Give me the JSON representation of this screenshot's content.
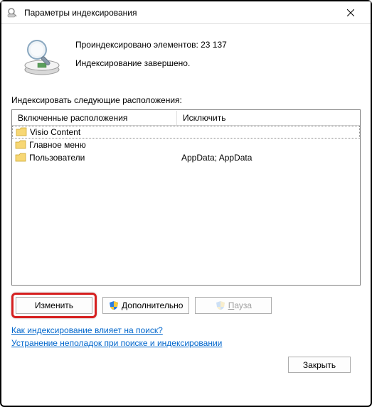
{
  "titlebar": {
    "title": "Параметры индексирования"
  },
  "status": {
    "indexed_label": "Проиндексировано элементов: 23 137",
    "state_label": "Индексирование завершено."
  },
  "section_label": "Индексировать следующие расположения:",
  "columns": {
    "included": "Включенные расположения",
    "excluded": "Исключить"
  },
  "rows": [
    {
      "name": "Visio Content",
      "excluded": ""
    },
    {
      "name": "Главное меню",
      "excluded": ""
    },
    {
      "name": "Пользователи",
      "excluded": "AppData; AppData"
    }
  ],
  "buttons": {
    "modify": "Изменить",
    "advanced": "Дополнительно",
    "pause": "Пауза",
    "close": "Закрыть"
  },
  "links": {
    "how_affects": "Как индексирование влияет на поиск?",
    "troubleshoot": "Устранение неполадок при поиске и индексировании"
  }
}
